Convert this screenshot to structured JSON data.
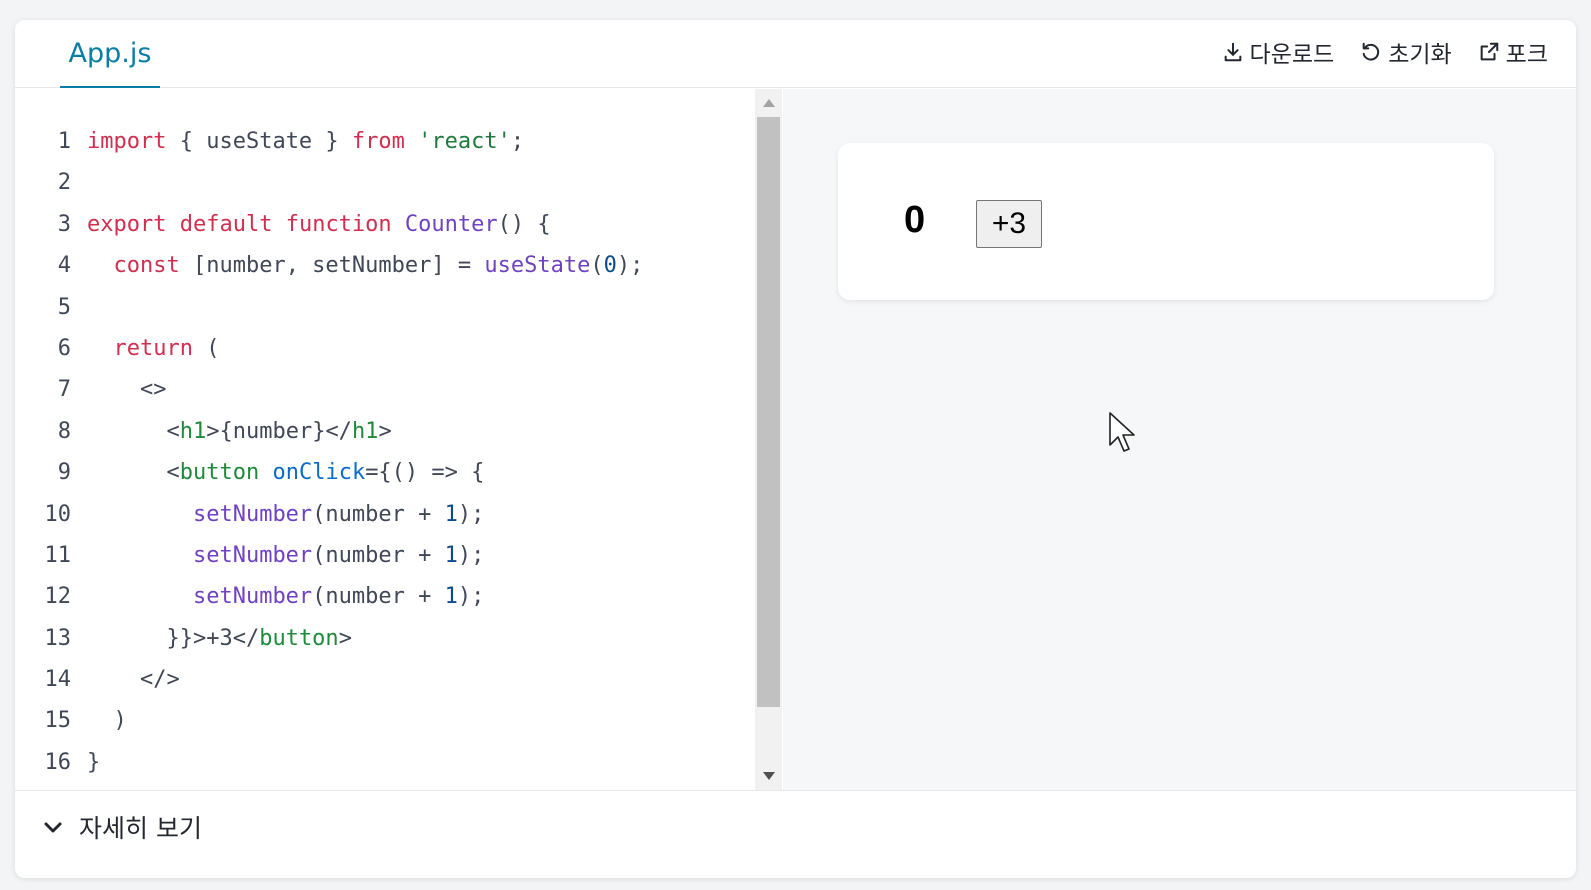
{
  "tab": {
    "label": "App.js"
  },
  "actions": {
    "download": "다운로드",
    "reset": "초기화",
    "fork": "포크"
  },
  "code_lines": [
    {
      "n": "1"
    },
    {
      "n": "2"
    },
    {
      "n": "3"
    },
    {
      "n": "4"
    },
    {
      "n": "5"
    },
    {
      "n": "6"
    },
    {
      "n": "7"
    },
    {
      "n": "8"
    },
    {
      "n": "9"
    },
    {
      "n": "10"
    },
    {
      "n": "11"
    },
    {
      "n": "12"
    },
    {
      "n": "13"
    },
    {
      "n": "14"
    },
    {
      "n": "15"
    },
    {
      "n": "16"
    }
  ],
  "code": {
    "l1": {
      "kw1": "import",
      "t1": " { useState } ",
      "kw2": "from",
      "t2": " ",
      "str": "'react'",
      "t3": ";"
    },
    "l3": {
      "kw1": "export",
      "kw2": "default",
      "kw3": "function",
      "fn": "Counter",
      "t": "() {"
    },
    "l4": {
      "kw": "const",
      "t1": " [number, setNumber] = ",
      "fn": "useState",
      "t2": "(",
      "num": "0",
      "t3": ");"
    },
    "l6": {
      "kw": "return",
      "t": " ("
    },
    "l7": {
      "t": "<>"
    },
    "l8": {
      "t1": "<",
      "tag1": "h1",
      "t2": ">{number}</",
      "tag2": "h1",
      "t3": ">"
    },
    "l9": {
      "t1": "<",
      "tag": "button",
      "t2": " ",
      "attr": "onClick",
      "t3": "={() => {"
    },
    "l10": {
      "fn": "setNumber",
      "t1": "(number + ",
      "num": "1",
      "t2": ");"
    },
    "l11": {
      "fn": "setNumber",
      "t1": "(number + ",
      "num": "1",
      "t2": ");"
    },
    "l12": {
      "fn": "setNumber",
      "t1": "(number + ",
      "num": "1",
      "t2": ");"
    },
    "l13": {
      "t1": "}}>+3</",
      "tag": "button",
      "t2": ">"
    },
    "l14": {
      "t": "</>"
    },
    "l15": {
      "t": ")"
    },
    "l16": {
      "t": "}"
    }
  },
  "preview": {
    "count": "0",
    "button_label": "+3"
  },
  "footer": {
    "show_more": "자세히 보기"
  },
  "colors": {
    "accent": "#087ea4",
    "keyword": "#d02f4f",
    "string": "#1f7a3e",
    "function": "#6f42c1",
    "tag": "#1f8a3a",
    "attribute": "#0b6bcb"
  },
  "icons": [
    "download-icon",
    "reset-icon",
    "fork-icon",
    "chevron-down-icon",
    "mouse-cursor-icon"
  ]
}
